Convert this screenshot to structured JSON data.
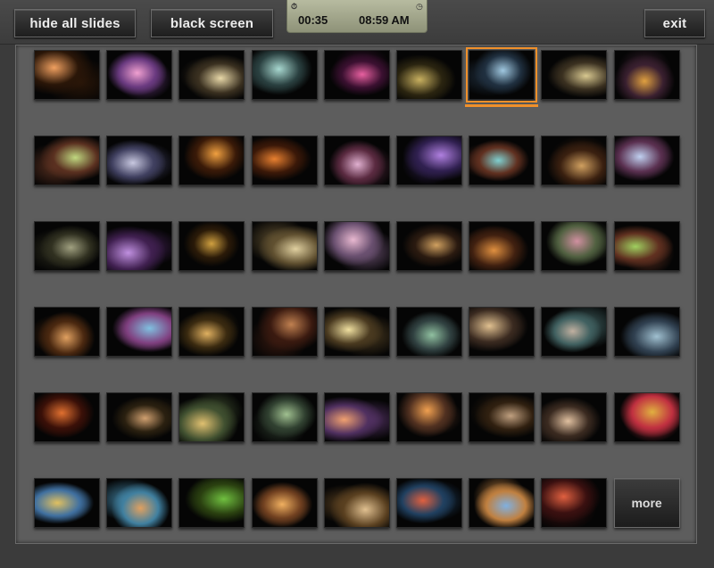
{
  "toolbar": {
    "hide_all_label": "hide all slides",
    "black_screen_label": "black screen",
    "exit_label": "exit"
  },
  "clock": {
    "elapsed": "00:35",
    "time": "08:59 AM",
    "stopwatch_icon": "stopwatch-icon",
    "clock_icon": "clock-icon"
  },
  "grid": {
    "columns": 9,
    "rows": 6,
    "selected_index": 6,
    "more_label": "more",
    "slides": [
      [
        "#f0a060",
        "#2a1608"
      ],
      [
        "#f0a0d0",
        "#6a3a80"
      ],
      [
        "#e8d8a8",
        "#3a3020"
      ],
      [
        "#a8d8d0",
        "#2a4040"
      ],
      [
        "#e860a0",
        "#3a1030"
      ],
      [
        "#c8b060",
        "#2a2410"
      ],
      [
        "#a0c8e0",
        "#203040"
      ],
      [
        "#d8c890",
        "#3a3020"
      ],
      [
        "#e0a040",
        "#3a2030"
      ],
      [
        "#c0d880",
        "#5a3020"
      ],
      [
        "#c8c8e0",
        "#404060"
      ],
      [
        "#f0a040",
        "#3a1a08"
      ],
      [
        "#e88030",
        "#3a1808"
      ],
      [
        "#e0b0d0",
        "#5a2a40"
      ],
      [
        "#b080e0",
        "#302050"
      ],
      [
        "#80d0d0",
        "#603020"
      ],
      [
        "#d0a060",
        "#3a2010"
      ],
      [
        "#c0d0f0",
        "#5a3050"
      ],
      [
        "#a0a080",
        "#303020"
      ],
      [
        "#c090e0",
        "#402050"
      ],
      [
        "#d0a040",
        "#2a1a08"
      ],
      [
        "#e0d0a0",
        "#605030"
      ],
      [
        "#e8b8d0",
        "#6a5070"
      ],
      [
        "#d0a060",
        "#2a1a10"
      ],
      [
        "#e09040",
        "#402010"
      ],
      [
        "#d090a0",
        "#506040"
      ],
      [
        "#a0d060",
        "#603020"
      ],
      [
        "#e0a060",
        "#4a2810"
      ],
      [
        "#80c0e0",
        "#804080"
      ],
      [
        "#e0b060",
        "#3a2a10"
      ],
      [
        "#c08050",
        "#3a1a10"
      ],
      [
        "#f0e0a0",
        "#4a3a20"
      ],
      [
        "#90c0a0",
        "#304040"
      ],
      [
        "#e0c090",
        "#3a2a20"
      ],
      [
        "#c0b0a0",
        "#406060"
      ],
      [
        "#a0c0d0",
        "#304050"
      ],
      [
        "#e07030",
        "#3a1008"
      ],
      [
        "#d0a070",
        "#2a2010"
      ],
      [
        "#e0c070",
        "#405030"
      ],
      [
        "#a0c090",
        "#304030"
      ],
      [
        "#f0a070",
        "#503060"
      ],
      [
        "#f0a050",
        "#503020"
      ],
      [
        "#c0a080",
        "#302010"
      ],
      [
        "#e0c0a0",
        "#3a2a20"
      ],
      [
        "#e0b040",
        "#c03040"
      ],
      [
        "#e0c060",
        "#4070a0"
      ],
      [
        "#e0a060",
        "#4080a0"
      ],
      [
        "#70c040",
        "#2a4010"
      ],
      [
        "#f0b060",
        "#704020"
      ],
      [
        "#e0c090",
        "#5a4020"
      ],
      [
        "#e06040",
        "#204060"
      ],
      [
        "#80b0e0",
        "#c08040"
      ],
      [
        "#e06040",
        "#3a1010"
      ]
    ]
  }
}
